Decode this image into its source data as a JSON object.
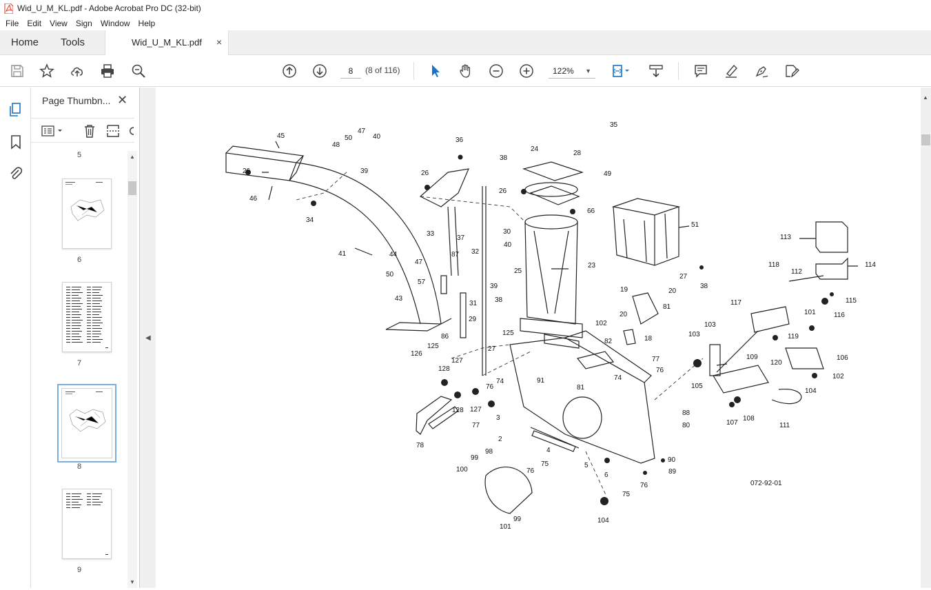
{
  "window": {
    "title": "Wid_U_M_KL.pdf - Adobe Acrobat Pro DC (32-bit)"
  },
  "menu": [
    "File",
    "Edit",
    "View",
    "Sign",
    "Window",
    "Help"
  ],
  "tabs": {
    "home": "Home",
    "tools": "Tools",
    "document": "Wid_U_M_KL.pdf",
    "close": "×"
  },
  "toolbar": {
    "current_page": "8",
    "page_count": "(8 of 116)",
    "zoom": "122%"
  },
  "panel": {
    "title": "Page Thumbn...",
    "close": "✕",
    "thumbnails": [
      {
        "label": "5"
      },
      {
        "label": "6"
      },
      {
        "label": "7"
      },
      {
        "label": "8"
      },
      {
        "label": "9"
      }
    ]
  },
  "drawing": {
    "code": "072-92-01",
    "part_labels": [
      "35",
      "45",
      "47",
      "48",
      "50",
      "40",
      "36",
      "24",
      "28",
      "49",
      "26",
      "39",
      "26",
      "38",
      "26",
      "66",
      "51",
      "113",
      "46",
      "34",
      "33",
      "37",
      "30",
      "40",
      "23",
      "114",
      "41",
      "44",
      "47",
      "32",
      "87",
      "25",
      "27",
      "38",
      "118",
      "112",
      "50",
      "57",
      "39",
      "19",
      "20",
      "115",
      "43",
      "31",
      "38",
      "81",
      "117",
      "116",
      "20",
      "29",
      "102",
      "103",
      "101",
      "103",
      "86",
      "125",
      "18",
      "119",
      "106",
      "82",
      "120",
      "126",
      "125",
      "27",
      "77",
      "109",
      "102",
      "127",
      "76",
      "105",
      "104",
      "128",
      "74",
      "91",
      "81",
      "128",
      "127",
      "76",
      "74",
      "88",
      "107",
      "108",
      "111",
      "77",
      "80",
      "3",
      "2",
      "78",
      "98",
      "4",
      "76",
      "75",
      "90",
      "99",
      "5",
      "6",
      "89",
      "100",
      "75",
      "76",
      "104",
      "99",
      "101"
    ]
  }
}
